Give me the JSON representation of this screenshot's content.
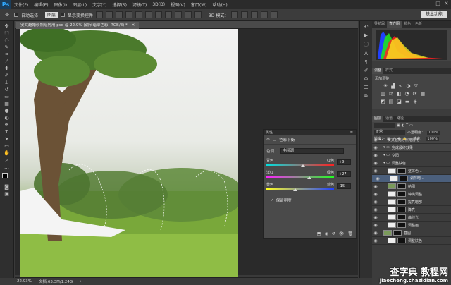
{
  "app": {
    "logo": "Ps"
  },
  "menubar": {
    "items": [
      "文件(F)",
      "编辑(E)",
      "图像(I)",
      "图层(L)",
      "文字(Y)",
      "选择(S)",
      "滤镜(T)",
      "3D(D)",
      "视图(V)",
      "窗口(W)",
      "帮助(H)"
    ]
  },
  "options": {
    "auto_select_label": "自动选择：",
    "auto_select_value": "图层",
    "transform_label": "显示变换控件",
    "mode_3d": "3D 模式：",
    "workspace": "基本功能"
  },
  "document": {
    "tab_title": "安文超婚纱照暗房用.psd @ 22.9% (调节暗部色彩, RGB/8) *",
    "zoom": "22.93%",
    "doc_size": "文档:63.3M/1.24G"
  },
  "properties": {
    "panel_title": "属性",
    "adjust_name": "色彩平衡",
    "tone_label": "色调：",
    "tone_value": "中间调",
    "sliders": [
      {
        "left": "青色",
        "right": "红色",
        "value": "+9",
        "pos": 0.54
      },
      {
        "left": "洋红",
        "right": "绿色",
        "value": "+27",
        "pos": 0.64
      },
      {
        "left": "黄色",
        "right": "蓝色",
        "value": "-15",
        "pos": 0.43
      }
    ],
    "preserve_label": "保留明度"
  },
  "histogram_tabs": [
    "导航器",
    "直方图",
    "颜色",
    "色板"
  ],
  "adjust_tabs": [
    "调整",
    "样式"
  ],
  "adjust_title": "添加调整",
  "layers_tabs": [
    "图层",
    "通道",
    "路径"
  ],
  "layers": {
    "blend_mode": "正常",
    "opacity_label": "不透明度：",
    "opacity": "100%",
    "fill_label": "填充：",
    "fill": "100%",
    "lock_label": "锁定：",
    "rows": [
      {
        "name": "安文超婚纱照暗房用",
        "indent": 0,
        "type": "group",
        "selected": false
      },
      {
        "name": "完成最终效果",
        "indent": 1,
        "type": "group",
        "selected": false
      },
      {
        "name": "夕阳",
        "indent": 1,
        "type": "group",
        "selected": false
      },
      {
        "name": "调整肤色",
        "indent": 1,
        "type": "group",
        "selected": false
      },
      {
        "name": "整体色...",
        "indent": 2,
        "type": "adjust",
        "selected": false
      },
      {
        "name": "调节暗...",
        "indent": 2,
        "type": "adjust",
        "selected": true
      },
      {
        "name": "柏图",
        "indent": 2,
        "type": "image",
        "selected": false
      },
      {
        "name": "种类调整",
        "indent": 2,
        "type": "adjust",
        "selected": false
      },
      {
        "name": "提亮暗部",
        "indent": 2,
        "type": "adjust",
        "selected": false
      },
      {
        "name": "降亮",
        "indent": 2,
        "type": "adjust",
        "selected": false
      },
      {
        "name": "曲线光",
        "indent": 2,
        "type": "adjust",
        "selected": false
      },
      {
        "name": "调整画...",
        "indent": 2,
        "type": "adjust",
        "selected": false
      },
      {
        "name": "基图",
        "indent": 1,
        "type": "image",
        "selected": false
      },
      {
        "name": "调整肤色",
        "indent": 2,
        "type": "adjust",
        "selected": false
      }
    ]
  },
  "watermark": {
    "line1": "查字典 教程网",
    "line2": "jiaocheng.chazidian.com"
  }
}
